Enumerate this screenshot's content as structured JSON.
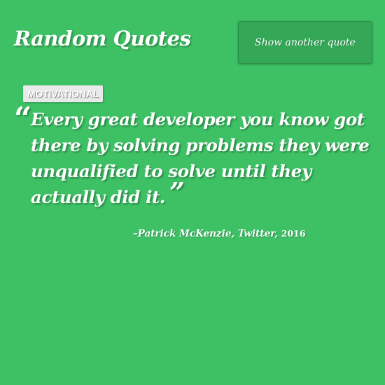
{
  "app": {
    "title": "Random Quotes"
  },
  "toolbar": {
    "show_another_label": "Show another quote"
  },
  "quote": {
    "category": "MOTIVATIONAL",
    "open_mark": "“",
    "lines": [
      "Every great developer you know got",
      "there by solving problems they were",
      "unqualified to solve until they",
      "actually did it."
    ],
    "close_mark": "”",
    "attribution_prefix": "–",
    "author": "Patrick McKenzie",
    "source": "Twitter",
    "year": "2016"
  },
  "colors": {
    "background": "#3ec165",
    "button_bg": "#35a857",
    "badge_bg": "#e9e9e9",
    "text": "#ffffff"
  }
}
